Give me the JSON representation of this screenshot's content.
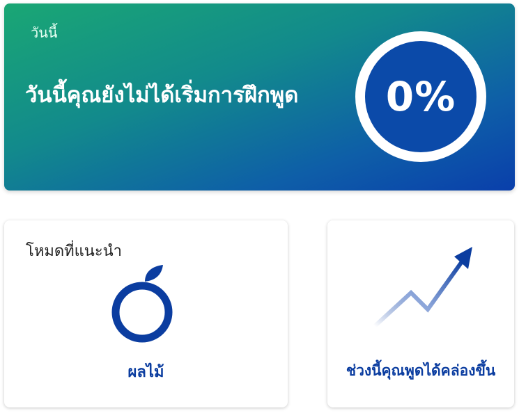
{
  "hero": {
    "label": "วันนี้",
    "headline": "วันนี้คุณยังไม่ได้เริ่มการฝึกพูด",
    "progress_text": "0%",
    "progress_value": 0
  },
  "recommended": {
    "title": "โหมดที่แนะนำ",
    "item_label": "ผลไม้",
    "icon": "fruit-icon"
  },
  "trend": {
    "label": "ช่วงนี้คุณพูดได้คล่องขึ้น",
    "icon": "trend-up-icon"
  },
  "colors": {
    "accent_blue": "#0b3da0",
    "gradient_start": "#1aa774",
    "gradient_end": "#0a3fab"
  }
}
